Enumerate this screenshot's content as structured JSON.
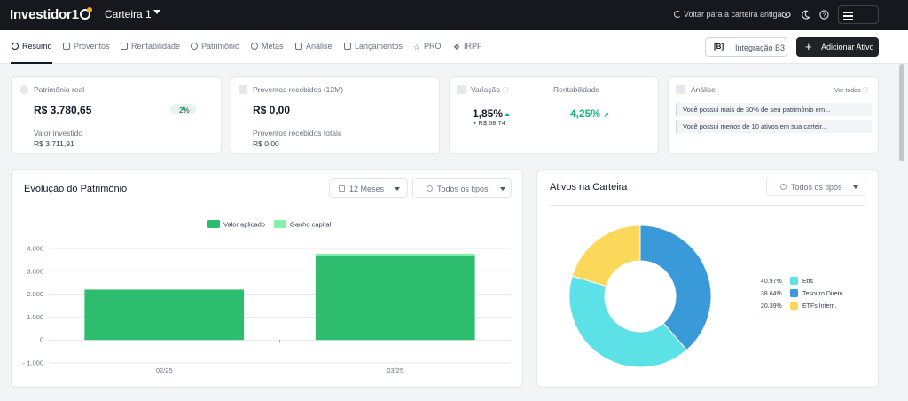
{
  "header": {
    "logo": "Investidor",
    "wallet": "Carteira 1",
    "back_link": "Voltar para a carteira antiga"
  },
  "tabs": [
    {
      "label": "Resumo"
    },
    {
      "label": "Proventos"
    },
    {
      "label": "Rentabilidade"
    },
    {
      "label": "Patrimônio"
    },
    {
      "label": "Metas"
    },
    {
      "label": "Análise"
    },
    {
      "label": "Lançamentos"
    },
    {
      "label": "PRO"
    },
    {
      "label": "IRPF"
    }
  ],
  "actions": {
    "b3_label": "Integração B3",
    "b3_mark": "[B]",
    "add_label": "Adicionar Ativo"
  },
  "cards": {
    "patrimonio": {
      "title": "Patrimônio real",
      "value": "R$ 3.780,65",
      "badge": "2%",
      "sub_label": "Valor investido",
      "sub_value": "R$ 3.711,91"
    },
    "proventos": {
      "title": "Proventos recebidos (12M)",
      "value": "R$ 0,00",
      "sub_label": "Proventos recebidos totais",
      "sub_value": "R$ 0,00"
    },
    "variacao": {
      "title": "Variação",
      "value": "1,85%",
      "sub": "+ R$ 68,74",
      "rent_title": "Rentabilidade",
      "rent_value": "4,25%"
    },
    "analise": {
      "title": "Análise",
      "see_all": "Ver todas",
      "alerts": [
        "Você possui mais de 30% de seu patrimônio em...",
        "Você possui menos de 10 ativos em sua carteir..."
      ]
    }
  },
  "evolucao": {
    "title": "Evolução do Patrimônio",
    "period": "12 Meses",
    "types": "Todos os tipos"
  },
  "ativos": {
    "title": "Ativos na Carteira",
    "types": "Todos os tipos"
  },
  "colors": {
    "valor_aplicado": "#2ebd6e",
    "ganho_capital": "#86efac",
    "etfs": "#5ce1e6",
    "tesouro": "#3a9ad9",
    "etfs_intern": "#fcd85a",
    "positive": "#10b981"
  },
  "chart_data": [
    {
      "type": "bar",
      "categories": [
        "02/25",
        "03/25"
      ],
      "series": [
        {
          "name": "Valor aplicado",
          "values": [
            2200,
            3700
          ]
        },
        {
          "name": "Ganho capital",
          "values": [
            0,
            70
          ]
        }
      ],
      "yticks": [
        "4.000",
        "3.000",
        "2.000",
        "1.000",
        "0",
        "- 1.000"
      ],
      "ylim": [
        -1000,
        4000
      ],
      "legend": "top"
    },
    {
      "type": "pie",
      "labels": [
        "Etfs",
        "Tesouro Direto",
        "ETFs Intern."
      ],
      "values": [
        40.97,
        38.64,
        20.39
      ],
      "percent_labels": [
        "40.97%",
        "38.64%",
        "20.39%"
      ],
      "legend": "right"
    }
  ]
}
